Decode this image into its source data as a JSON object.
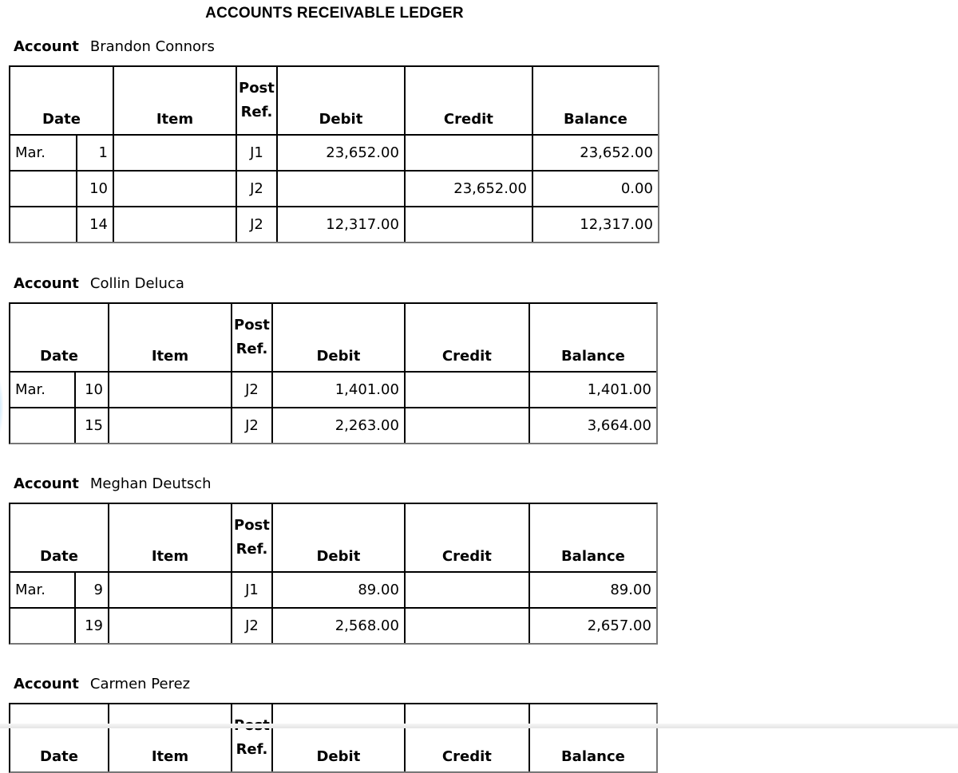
{
  "title": "ACCOUNTS RECEIVABLE LEDGER",
  "account_label": "Account",
  "columns": {
    "date": "Date",
    "item": "Item",
    "post_ref_line1": "Post",
    "post_ref_line2": "Ref.",
    "debit": "Debit",
    "credit": "Credit",
    "balance": "Balance"
  },
  "accounts": [
    {
      "name": "Brandon Connors",
      "rows": [
        {
          "month": "Mar.",
          "day": "1",
          "item": "",
          "ref": "J1",
          "debit": "23,652.00",
          "credit": "",
          "balance": "23,652.00"
        },
        {
          "month": "",
          "day": "10",
          "item": "",
          "ref": "J2",
          "debit": "",
          "credit": "23,652.00",
          "balance": "0.00"
        },
        {
          "month": "",
          "day": "14",
          "item": "",
          "ref": "J2",
          "debit": "12,317.00",
          "credit": "",
          "balance": "12,317.00"
        }
      ]
    },
    {
      "name": "Collin Deluca",
      "rows": [
        {
          "month": "Mar.",
          "day": "10",
          "item": "",
          "ref": "J2",
          "debit": "1,401.00",
          "credit": "",
          "balance": "1,401.00"
        },
        {
          "month": "",
          "day": "15",
          "item": "",
          "ref": "J2",
          "debit": "2,263.00",
          "credit": "",
          "balance": "3,664.00"
        }
      ]
    },
    {
      "name": "Meghan Deutsch",
      "rows": [
        {
          "month": "Mar.",
          "day": "9",
          "item": "",
          "ref": "J1",
          "debit": "89.00",
          "credit": "",
          "balance": "89.00"
        },
        {
          "month": "",
          "day": "19",
          "item": "",
          "ref": "J2",
          "debit": "2,568.00",
          "credit": "",
          "balance": "2,657.00"
        }
      ]
    },
    {
      "name": "Carmen Perez",
      "rows": []
    }
  ]
}
